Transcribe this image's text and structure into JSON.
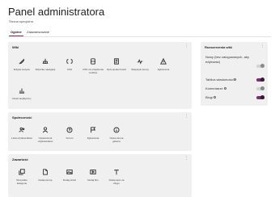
{
  "header": {
    "title": "Panel administratora",
    "subtitle": "Strona specjalna"
  },
  "tabs": [
    {
      "label": "Ogólne"
    },
    {
      "label": "Zaawansowane"
    }
  ],
  "wiki": {
    "title": "Wiki",
    "menu": "⋮",
    "tiles": [
      {
        "label": "Edycja motywu",
        "icon": "brush-icon"
      },
      {
        "label": "Wtyczka nawigacji",
        "icon": "navigation-icon"
      },
      {
        "label": "CSS",
        "icon": "code-icon"
      },
      {
        "label": "CSS na urządzenia mobilne",
        "icon": "mobile-code-icon"
      },
      {
        "label": "Opis społeczności",
        "icon": "description-icon"
      },
      {
        "label": "Statystyki strony",
        "icon": "stats-icon"
      },
      {
        "label": "Zgłoszenia",
        "icon": "warning-icon"
      },
      {
        "label": "Panel analityczny",
        "icon": "analytics-icon"
      }
    ]
  },
  "social": {
    "title": "Społeczność",
    "menu": "⋮",
    "tiles": [
      {
        "label": "Lista użytkowników",
        "icon": "users-icon"
      },
      {
        "label": "Uprawnienia użytkowników",
        "icon": "user-rights-icon"
      },
      {
        "label": "Forum",
        "icon": "forum-icon"
      },
      {
        "label": "Zgłoszenia",
        "icon": "flag-icon"
      },
      {
        "label": "Nowa strona główna",
        "icon": "info-icon"
      }
    ]
  },
  "content": {
    "title": "Zawartość",
    "menu": "⋮",
    "tiles": [
      {
        "label": "Wszystkie kategorie",
        "icon": "categories-icon"
      },
      {
        "label": "Dodaj stronę",
        "icon": "add-page-icon"
      },
      {
        "label": "Dodaj obraz",
        "icon": "image-icon"
      },
      {
        "label": "Dodaj film",
        "icon": "video-icon"
      },
      {
        "label": "Dodaj wpis na blogu",
        "icon": "text-icon"
      }
    ]
  },
  "extensions": {
    "title": "Rozszerzenia wiki",
    "menu": "⋮",
    "items": [
      {
        "label": "Nowy (bez zalogowanych, aby edytować)",
        "enabled": false
      },
      {
        "label": "Tablica wiadomości",
        "enabled": true
      },
      {
        "label": "Komentarze",
        "enabled": false
      },
      {
        "label": "Blogi",
        "enabled": true
      }
    ]
  }
}
